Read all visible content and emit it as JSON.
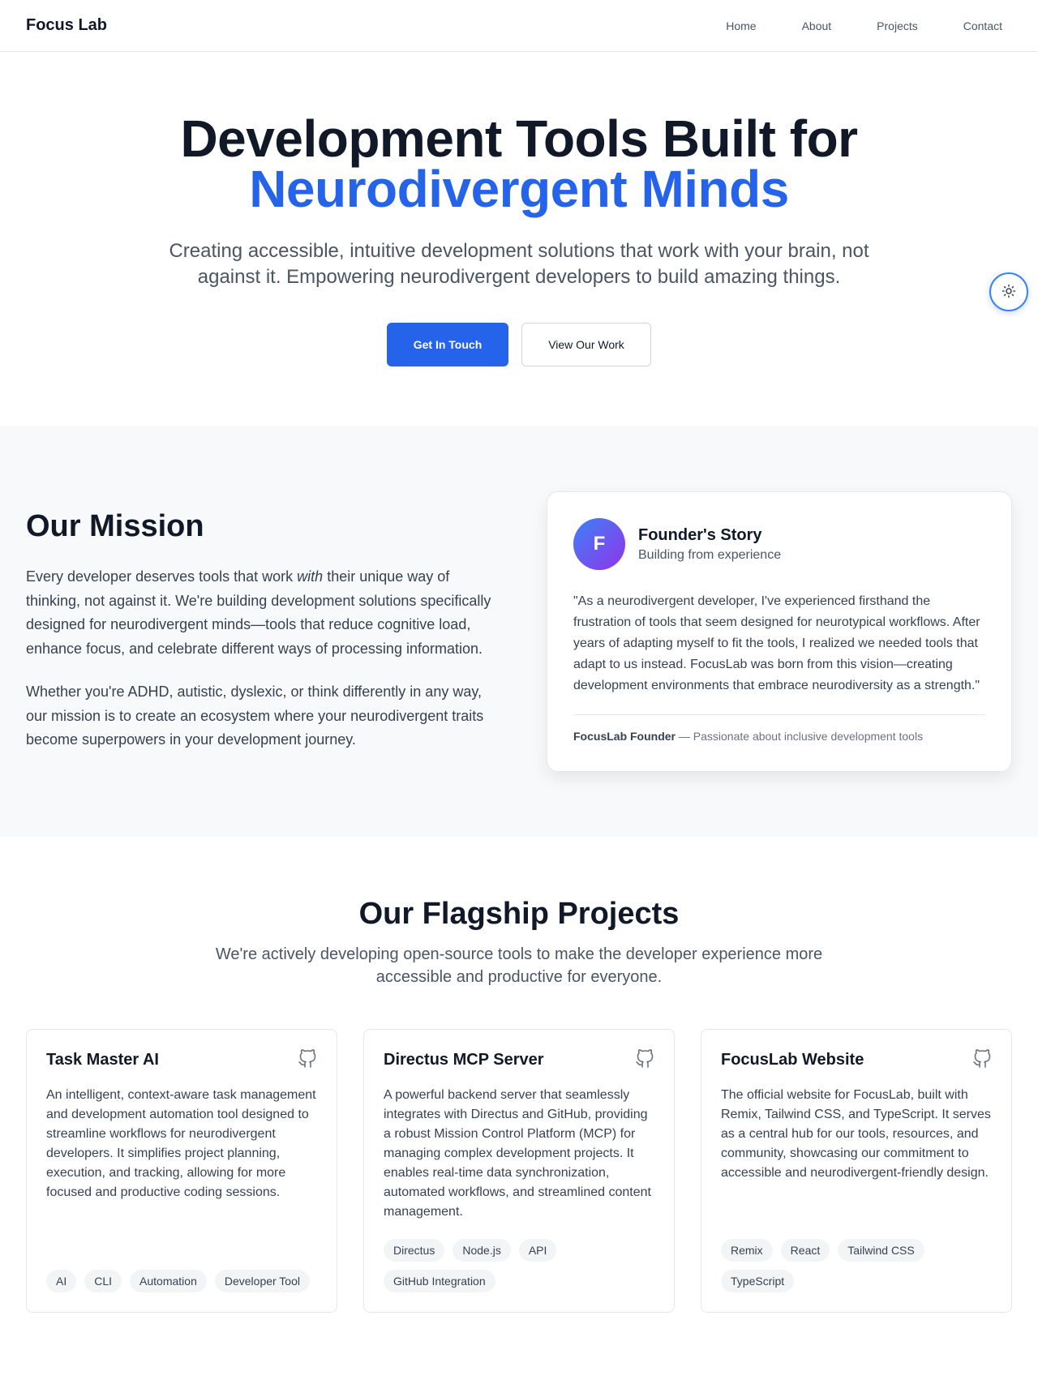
{
  "nav": {
    "brand": "Focus Lab",
    "links": [
      "Home",
      "About",
      "Projects",
      "Contact"
    ]
  },
  "hero": {
    "title_line1": "Development Tools Built for",
    "title_line2": "Neurodivergent Minds",
    "subtitle": "Creating accessible, intuitive development solutions that work with your brain, not against it. Empowering neurodivergent developers to build amazing things.",
    "primary_cta": "Get In Touch",
    "secondary_cta": "View Our Work",
    "theme_toggle_icon": "sun-icon"
  },
  "mission": {
    "heading": "Our Mission",
    "p1_before": "Every developer deserves tools that work ",
    "p1_em": "with",
    "p1_after": " their unique way of thinking, not against it. We're building development solutions specifically designed for neurodivergent minds—tools that reduce cognitive load, enhance focus, and celebrate different ways of processing information.",
    "p2": "Whether you're ADHD, autistic, dyslexic, or think differently in any way, our mission is to create an ecosystem where your neurodivergent traits become superpowers in your development journey."
  },
  "founder": {
    "avatar_letter": "F",
    "title": "Founder's Story",
    "subtitle": "Building from experience",
    "quote": "\"As a neurodivergent developer, I've experienced firsthand the frustration of tools that seem designed for neurotypical workflows. After years of adapting myself to fit the tools, I realized we needed tools that adapt to us instead. FocusLab was born from this vision—creating development environments that embrace neurodiversity as a strength.\"",
    "sig_name": "FocusLab Founder",
    "sig_sep": " — ",
    "sig_desc": "Passionate about inclusive development tools"
  },
  "projects": {
    "heading": "Our Flagship Projects",
    "subtitle": "We're actively developing open-source tools to make the developer experience more accessible and productive for everyone.",
    "items": [
      {
        "title": "Task Master AI",
        "description": "An intelligent, context-aware task management and development automation tool designed to streamline workflows for neurodivergent developers. It simplifies project planning, execution, and tracking, allowing for more focused and productive coding sessions.",
        "tags": [
          "AI",
          "CLI",
          "Automation",
          "Developer Tool"
        ],
        "icon": "github-icon"
      },
      {
        "title": "Directus MCP Server",
        "description": "A powerful backend server that seamlessly integrates with Directus and GitHub, providing a robust Mission Control Platform (MCP) for managing complex development projects. It enables real-time data synchronization, automated workflows, and streamlined content management.",
        "tags": [
          "Directus",
          "Node.js",
          "API",
          "GitHub Integration"
        ],
        "icon": "github-icon"
      },
      {
        "title": "FocusLab Website",
        "description": "The official website for FocusLab, built with Remix, Tailwind CSS, and TypeScript. It serves as a central hub for our tools, resources, and community, showcasing our commitment to accessible and neurodivergent-friendly design.",
        "tags": [
          "Remix",
          "React",
          "Tailwind CSS",
          "TypeScript"
        ],
        "icon": "github-icon"
      }
    ]
  },
  "colors": {
    "accent": "#2563eb",
    "text": "#111827",
    "muted": "#4b5563",
    "section_bg": "#f8f9fb"
  }
}
